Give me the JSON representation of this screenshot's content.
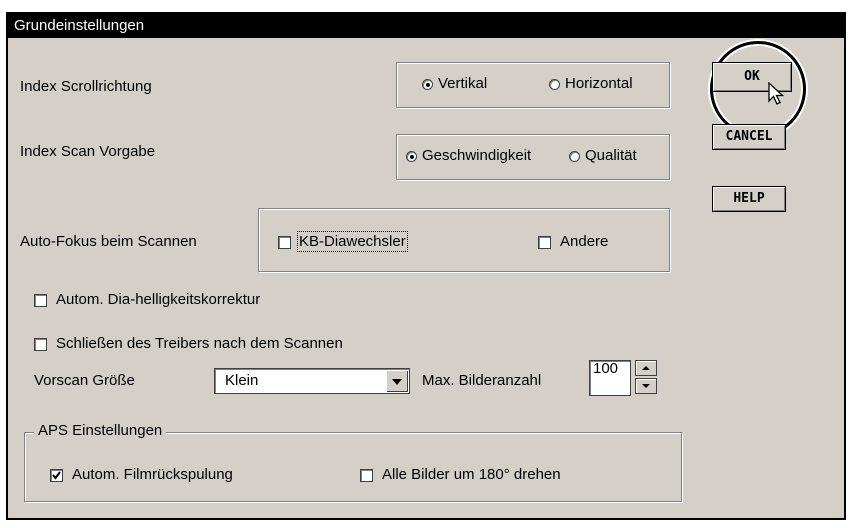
{
  "window": {
    "title": "Grundeinstellungen"
  },
  "scroll_direction": {
    "label": "Index Scrollrichtung",
    "options": [
      {
        "label": "Vertikal",
        "selected": true
      },
      {
        "label": "Horizontal",
        "selected": false
      }
    ]
  },
  "scan_default": {
    "label": "Index Scan Vorgabe",
    "options": [
      {
        "label": "Geschwindigkeit",
        "selected": true
      },
      {
        "label": "Qualität",
        "selected": false
      }
    ]
  },
  "autofocus": {
    "label": "Auto-Fokus beim Scannen",
    "options": [
      {
        "label": "KB-Diawechsler",
        "checked": false
      },
      {
        "label": "Andere",
        "checked": false
      }
    ]
  },
  "options": [
    {
      "label": "Autom. Dia-helligkeitskorrektur",
      "checked": false
    },
    {
      "label": "Schließen des Treibers nach dem Scannen",
      "checked": false
    }
  ],
  "prescan": {
    "label": "Vorscan Größe",
    "value": "Klein"
  },
  "max_images": {
    "label": "Max. Bilderanzahl",
    "value": "100"
  },
  "aps": {
    "title": "APS Einstellungen",
    "options": [
      {
        "label": "Autom. Filmrückspulung",
        "checked": true
      },
      {
        "label": "Alle Bilder um 180° drehen",
        "checked": false
      }
    ]
  },
  "buttons": {
    "ok": "OK",
    "cancel": "CANCEL",
    "help": "HELP"
  }
}
